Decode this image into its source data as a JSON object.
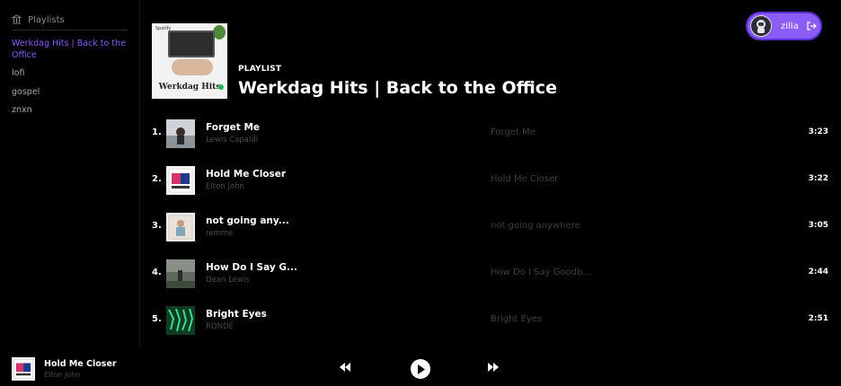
{
  "sidebar": {
    "header_label": "Playlists",
    "items": [
      {
        "label": "Werkdag Hits | Back to the Office",
        "active": true
      },
      {
        "label": "lofi",
        "active": false
      },
      {
        "label": "gospel",
        "active": false
      },
      {
        "label": "znxn",
        "active": false
      }
    ]
  },
  "playlist": {
    "type_label": "PLAYLIST",
    "title": "Werkdag Hits | Back to the Office",
    "cover_brand": "Spotify",
    "cover_title": "Werkdag Hits"
  },
  "user": {
    "name": "zilla",
    "avatar_icon": "astronaut-avatar",
    "logout_icon": "logout-icon"
  },
  "tracks": [
    {
      "num": "1.",
      "name": "Forget Me",
      "artist": "Lewis Capaldi",
      "album": "Forget Me",
      "duration": "3:23"
    },
    {
      "num": "2.",
      "name": "Hold Me Closer",
      "artist": "Elton John",
      "album": "Hold Me Closer",
      "duration": "3:22"
    },
    {
      "num": "3.",
      "name": "not going any...",
      "artist": "remme",
      "album": "not going anywhere",
      "duration": "3:05"
    },
    {
      "num": "4.",
      "name": "How Do I Say G...",
      "artist": "Dean Lewis",
      "album": "How Do I Say Goodb...",
      "duration": "2:44"
    },
    {
      "num": "5.",
      "name": "Bright Eyes",
      "artist": "RONDE",
      "album": "Bright Eyes",
      "duration": "2:51"
    }
  ],
  "player": {
    "title": "Hold Me Closer",
    "artist": "Elton John",
    "prev_icon": "skip-back-icon",
    "play_icon": "play-icon",
    "next_icon": "skip-forward-icon"
  },
  "colors": {
    "accent": "#8b5cf6",
    "background": "#000000",
    "muted_text": "#4a4a4a"
  }
}
